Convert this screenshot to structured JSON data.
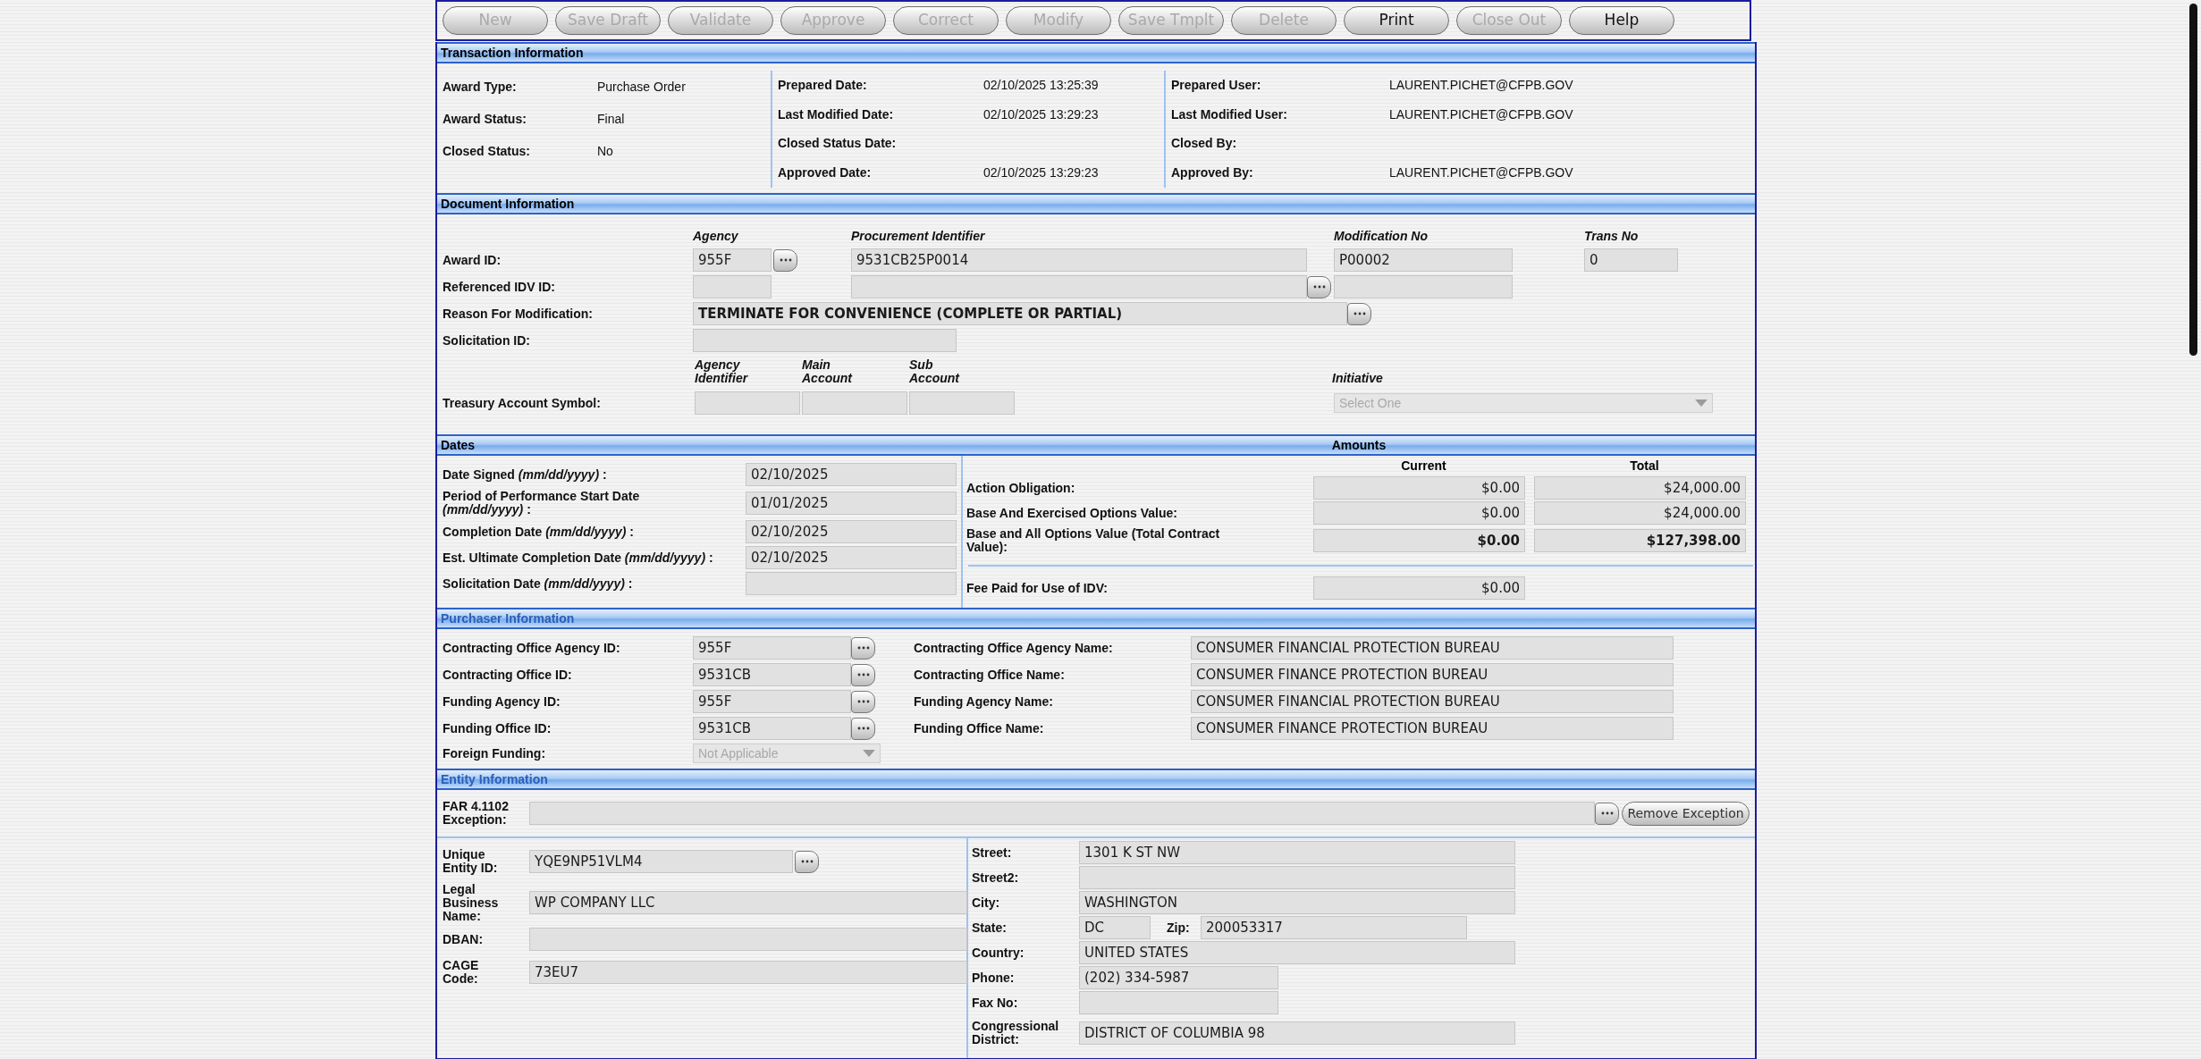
{
  "toolbar": [
    {
      "label": "New",
      "disabled": true
    },
    {
      "label": "Save Draft",
      "disabled": true
    },
    {
      "label": "Validate",
      "disabled": true
    },
    {
      "label": "Approve",
      "disabled": true
    },
    {
      "label": "Correct",
      "disabled": true
    },
    {
      "label": "Modify",
      "disabled": true
    },
    {
      "label": "Save Tmplt",
      "disabled": true
    },
    {
      "label": "Delete",
      "disabled": true
    },
    {
      "label": "Print",
      "disabled": false
    },
    {
      "label": "Close Out",
      "disabled": true
    },
    {
      "label": "Help",
      "disabled": false
    }
  ],
  "transaction_information": {
    "header": {
      "text": "Transaction Information",
      "color": "#000000"
    },
    "columns": [
      [
        {
          "label": "Award Type:",
          "value": "Purchase Order"
        },
        {
          "label": "Award Status:",
          "value": "Final"
        },
        {
          "label": "Closed Status:",
          "value": "No"
        }
      ],
      [
        {
          "label": "Prepared Date:",
          "value": "02/10/2025 13:25:39"
        },
        {
          "label": "Last Modified Date:",
          "value": "02/10/2025 13:29:23"
        },
        {
          "label": "Closed Status Date:"
        },
        {
          "label": "Approved Date:",
          "value": "02/10/2025 13:29:23"
        }
      ],
      [
        {
          "label": "Prepared User:",
          "value": "LAURENT.PICHET@CFPB.GOV"
        },
        {
          "label": "Last Modified User:",
          "value": "LAURENT.PICHET@CFPB.GOV"
        },
        {
          "label": "Closed By:"
        },
        {
          "label": "Approved By:",
          "value": "LAURENT.PICHET@CFPB.GOV"
        }
      ]
    ]
  },
  "document_information": {
    "header": {
      "text": "Document Information",
      "color": "#000000"
    },
    "column_headings": [
      "Agency",
      "Procurement Identifier",
      "Modification No",
      "Trans No"
    ],
    "award_id": {
      "label": "Award ID:",
      "agency": "955F",
      "procurement_identifier": "9531CB25P0014",
      "modification_no": "P00002",
      "trans_no": "0"
    },
    "referenced_idv_id": {
      "label": "Referenced IDV ID:"
    },
    "reason_for_modification": {
      "label": "Reason For Modification:",
      "value": "TERMINATE FOR CONVENIENCE (COMPLETE OR PARTIAL)"
    },
    "solicitation_id": {
      "label": "Solicitation ID:"
    },
    "tas_headings": [
      "Agency Identifier",
      "Main Account",
      "Sub Account"
    ],
    "initiative": {
      "heading": "Initiative",
      "placeholder": "Select One",
      "disabled": true
    },
    "treasury_account_symbol": {
      "label": "Treasury Account Symbol:"
    }
  },
  "dates": {
    "header": {
      "text": "Dates",
      "color": "#000000"
    },
    "rows": [
      {
        "label": "Date Signed *(mm/dd/yyyy)* :",
        "value": "02/10/2025"
      },
      {
        "label": "Period of Performance Start Date *(mm/dd/yyyy)* :",
        "value": "01/01/2025"
      },
      {
        "label": "Completion Date *(mm/dd/yyyy)* :",
        "value": "02/10/2025"
      },
      {
        "label": "Est. Ultimate Completion Date *(mm/dd/yyyy)* :",
        "value": "02/10/2025"
      },
      {
        "label": "Solicitation Date *(mm/dd/yyyy)* :"
      }
    ]
  },
  "amounts": {
    "header": {
      "text": "Amounts",
      "color": "#000000"
    },
    "column_headings": [
      "Current",
      "Total"
    ],
    "rows": [
      {
        "label": "Action Obligation:",
        "current": "$0.00",
        "total": "$24,000.00",
        "bold": false
      },
      {
        "label": "Base And Exercised Options Value:",
        "current": "$0.00",
        "total": "$24,000.00",
        "bold": false
      },
      {
        "label": "Base and All Options Value (Total Contract Value):",
        "current": "$0.00",
        "total": "$127,398.00",
        "bold": true
      }
    ],
    "fee": {
      "label": "Fee Paid for Use of IDV:",
      "current": "$0.00"
    }
  },
  "purchaser_information": {
    "header": {
      "text": "Purchaser Information",
      "color": "#2b5fb8"
    },
    "rows": [
      {
        "id_label": "Contracting Office Agency ID:",
        "id": "955F",
        "name_label": "Contracting Office Agency Name:",
        "name": "CONSUMER FINANCIAL PROTECTION BUREAU"
      },
      {
        "id_label": "Contracting Office ID:",
        "id": "9531CB",
        "name_label": "Contracting Office Name:",
        "name": "CONSUMER FINANCE PROTECTION BUREAU"
      },
      {
        "id_label": "Funding Agency ID:",
        "id": "955F",
        "name_label": "Funding Agency Name:",
        "name": "CONSUMER FINANCIAL PROTECTION BUREAU"
      },
      {
        "id_label": "Funding Office ID:",
        "id": "9531CB",
        "name_label": "Funding Office Name:",
        "name": "CONSUMER FINANCE PROTECTION BUREAU"
      }
    ],
    "foreign_funding": {
      "label": "Foreign Funding:",
      "value": "Not Applicable",
      "disabled": true
    }
  },
  "entity_information": {
    "header": {
      "text": "Entity Information",
      "color": "#2b5fb8"
    },
    "far_exception": {
      "label": "FAR 4.1102 Exception:",
      "button": "Remove Exception"
    },
    "left": [
      {
        "kind": "lookup",
        "label": "Unique Entity ID:",
        "value": "YQE9NP51VLM4"
      },
      {
        "kind": "text",
        "label": "Legal Business Name:",
        "value": "WP COMPANY LLC"
      },
      {
        "kind": "text",
        "label": "DBAN:"
      },
      {
        "kind": "text",
        "label": "CAGE Code:",
        "value": "73EU7"
      }
    ],
    "address": [
      {
        "kind": "wide",
        "label": "Street:",
        "value": "1301 K ST NW"
      },
      {
        "kind": "wide",
        "label": "Street2:"
      },
      {
        "kind": "wide",
        "label": "City:",
        "value": "WASHINGTON"
      },
      {
        "kind": "state_zip",
        "label": "State:",
        "value": "DC",
        "zip_label": "Zip:",
        "zip": "200053317"
      },
      {
        "kind": "wide",
        "label": "Country:",
        "value": "UNITED STATES"
      },
      {
        "kind": "short",
        "label": "Phone:",
        "value": "(202) 334-5987"
      },
      {
        "kind": "short",
        "label": "Fax No:"
      },
      {
        "kind": "tall",
        "label": "Congressional District:",
        "value": "DISTRICT OF COLUMBIA 98"
      }
    ]
  }
}
